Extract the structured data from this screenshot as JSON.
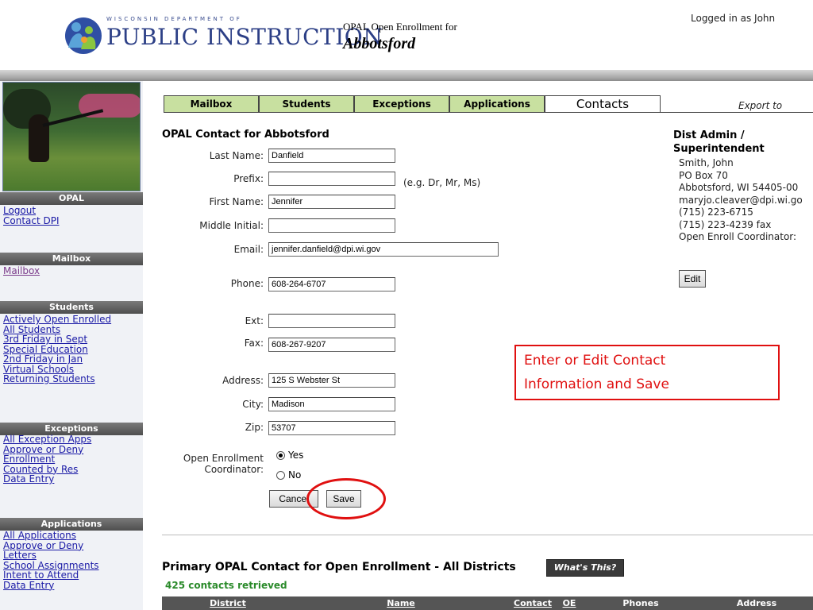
{
  "header": {
    "logo_small": "WISCONSIN DEPARTMENT OF",
    "logo_big": "PUBLIC INSTRUCTION",
    "app_title": "OPAL Open Enrollment for",
    "district": "Abbotsford",
    "login_text": "Logged in as John"
  },
  "sidebar": {
    "opal_header": "OPAL",
    "opal_links": [
      "Logout",
      "Contact DPI"
    ],
    "mailbox_header": "Mailbox",
    "mailbox_links": [
      "Mailbox"
    ],
    "students_header": "Students",
    "students_links": [
      "Actively Open Enrolled",
      "All Students",
      "3rd Friday in Sept",
      "Special Education",
      "2nd Friday in Jan",
      "Virtual Schools",
      "Returning Students"
    ],
    "exceptions_header": "Exceptions",
    "exceptions_links": [
      "All Exception Apps",
      "Approve or Deny",
      "Enrollment",
      "Counted by Res",
      "Data Entry"
    ],
    "applications_header": "Applications",
    "applications_links": [
      "All Applications",
      "Approve or Deny",
      "Letters",
      "School Assignments",
      "Intent to Attend",
      "Data Entry"
    ]
  },
  "tabs": [
    "Mailbox",
    "Students",
    "Exceptions",
    "Applications",
    "Contacts"
  ],
  "export_label": "Export to",
  "form": {
    "title": "OPAL Contact for Abbotsford",
    "last_name_label": "Last Name:",
    "last_name": "Danfield",
    "prefix_label": "Prefix:",
    "prefix": "",
    "prefix_hint": "(e.g. Dr, Mr, Ms)",
    "first_name_label": "First Name:",
    "first_name": "Jennifer",
    "middle_label": "Middle Initial:",
    "middle": "",
    "email_label": "Email:",
    "email": "jennifer.danfield@dpi.wi.gov",
    "phone_label": "Phone:",
    "phone": "608-264-6707",
    "ext_label": "Ext:",
    "ext": "",
    "fax_label": "Fax:",
    "fax": "608-267-9207",
    "address_label": "Address:",
    "address": "125 S Webster St",
    "city_label": "City:",
    "city": "Madison",
    "zip_label": "Zip:",
    "zip": "53707",
    "coord_label_1": "Open Enrollment",
    "coord_label_2": "Coordinator:",
    "yes_label": "Yes",
    "no_label": "No",
    "coordinator": "Yes",
    "cancel_label": "Cancel",
    "save_label": "Save"
  },
  "admin": {
    "title_1": "Dist Admin /",
    "title_2": "Superintendent",
    "lines": [
      "Smith, John",
      "PO Box 70",
      "Abbotsford, WI 54405-00",
      "maryjo.cleaver@dpi.wi.go",
      "(715) 223-6715",
      "(715) 223-4239 fax",
      "Open Enroll Coordinator:"
    ],
    "edit_label": "Edit"
  },
  "annotation": {
    "line1": "Enter or Edit Contact",
    "line2": "Information and Save",
    "color": "#e01010"
  },
  "primary": {
    "title": "Primary OPAL Contact for Open Enrollment - All Districts",
    "whats_this": "What's This?",
    "count": "425 contacts retrieved",
    "columns": [
      "District",
      "Name",
      "Contact",
      "OE",
      "Phones",
      "Address"
    ]
  },
  "colors": {
    "tab_green": "#c8e0a0",
    "sidebar_header": "#555555",
    "count_green": "#2a8a2a"
  }
}
